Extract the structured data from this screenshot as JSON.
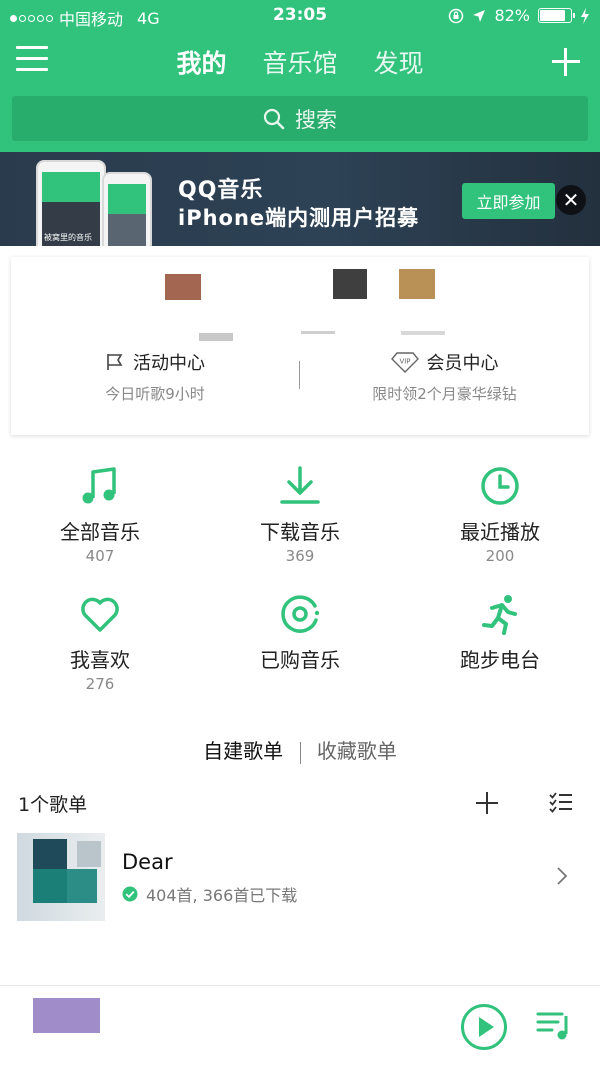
{
  "status_bar": {
    "carrier": "中国移动",
    "network": "4G",
    "time": "23:05",
    "battery": "82%",
    "battery_level": 0.82
  },
  "header": {
    "tabs": [
      {
        "label": "我的",
        "active": true
      },
      {
        "label": "音乐馆",
        "active": false
      },
      {
        "label": "发现",
        "active": false
      }
    ],
    "search_placeholder": "搜索"
  },
  "banner": {
    "title": "QQ音乐",
    "subtitle": "iPhone端内测用户招募",
    "phone_caption": "被窝里的音乐",
    "join_label": "立即参加"
  },
  "profile_card": {
    "activity": {
      "title": "活动中心",
      "subtitle": "今日听歌9小时"
    },
    "vip": {
      "title": "会员中心",
      "subtitle": "限时领2个月豪华绿钻",
      "badge": "VIP"
    }
  },
  "library": [
    {
      "label": "全部音乐",
      "count": "407",
      "icon": "music-note-icon"
    },
    {
      "label": "下载音乐",
      "count": "369",
      "icon": "download-icon"
    },
    {
      "label": "最近播放",
      "count": "200",
      "icon": "clock-icon"
    },
    {
      "label": "我喜欢",
      "count": "276",
      "icon": "heart-icon"
    },
    {
      "label": "已购音乐",
      "count": "",
      "icon": "purchased-disc-icon"
    },
    {
      "label": "跑步电台",
      "count": "",
      "icon": "running-icon"
    }
  ],
  "playlists": {
    "tabs": [
      {
        "label": "自建歌单",
        "active": true
      },
      {
        "label": "收藏歌单",
        "active": false
      }
    ],
    "count_label": "1个歌单",
    "items": [
      {
        "name": "Dear",
        "info": "404首, 366首已下载"
      }
    ]
  },
  "colors": {
    "accent": "#31c27c",
    "search_bg": "#29ad6d",
    "banner_bg": "#2a3b4d"
  }
}
